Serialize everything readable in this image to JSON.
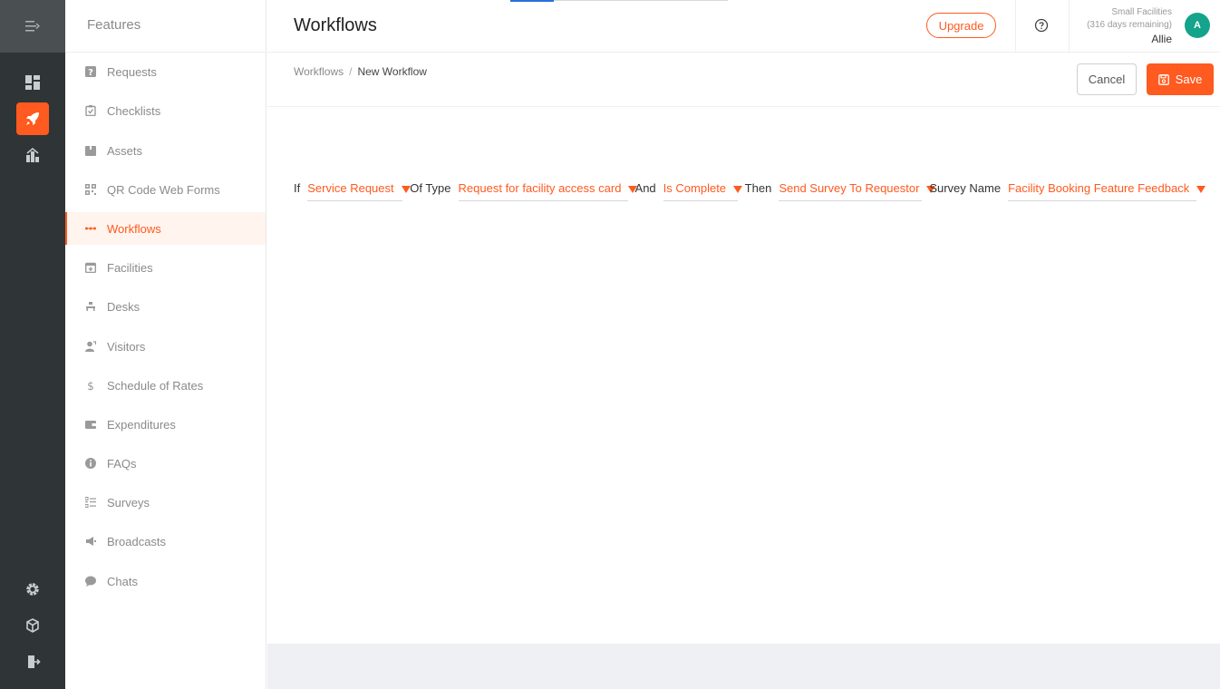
{
  "rail": {
    "items": [
      {
        "name": "dashboard-icon"
      },
      {
        "name": "rocket-icon",
        "active": true
      },
      {
        "name": "analytics-icon"
      }
    ],
    "bottom": [
      {
        "name": "gear-icon"
      },
      {
        "name": "cube-icon"
      },
      {
        "name": "logout-icon"
      }
    ]
  },
  "sidebar": {
    "title": "Features",
    "items": [
      {
        "label": "Requests",
        "icon": "question-icon"
      },
      {
        "label": "Checklists",
        "icon": "clipboard-check-icon"
      },
      {
        "label": "Assets",
        "icon": "box-icon"
      },
      {
        "label": "QR Code Web Forms",
        "icon": "qr-code-icon"
      },
      {
        "label": "Workflows",
        "icon": "workflow-icon",
        "active": true
      },
      {
        "label": "Facilities",
        "icon": "calendar-plus-icon"
      },
      {
        "label": "Desks",
        "icon": "desk-icon"
      },
      {
        "label": "Visitors",
        "icon": "visitor-icon"
      },
      {
        "label": "Schedule of Rates",
        "icon": "dollar-icon"
      },
      {
        "label": "Expenditures",
        "icon": "wallet-icon"
      },
      {
        "label": "FAQs",
        "icon": "info-icon"
      },
      {
        "label": "Surveys",
        "icon": "list-check-icon"
      },
      {
        "label": "Broadcasts",
        "icon": "megaphone-icon"
      },
      {
        "label": "Chats",
        "icon": "chat-icon"
      }
    ]
  },
  "header": {
    "title": "Workflows",
    "upgrade_label": "Upgrade",
    "account": {
      "org": "Small Facilities",
      "remaining": "(316 days remaining)",
      "user": "Allie",
      "avatar_initial": "A"
    }
  },
  "breadcrumb": {
    "parent": "Workflows",
    "separator": "/",
    "current": "New Workflow"
  },
  "actions": {
    "cancel_label": "Cancel",
    "save_label": "Save"
  },
  "rule": {
    "if_label": "If",
    "trigger": "Service Request",
    "of_type_label": "Of Type",
    "type": "Request for facility access card",
    "and_label": "And",
    "condition": "Is Complete",
    "then_label": "Then",
    "action": "Send Survey To Requestor",
    "survey_name_label": "Survey Name",
    "survey": "Facility Booking Feature Feedback"
  },
  "colors": {
    "accent": "#ff5a1f",
    "rail": "#2f3437",
    "avatar": "#14a38b"
  }
}
